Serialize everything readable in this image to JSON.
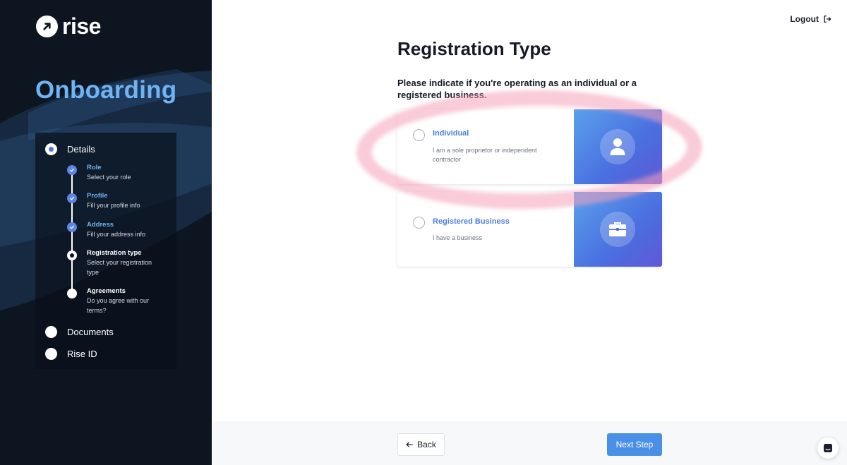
{
  "brand": {
    "logo_text": "rise",
    "logo_icon": "arrow-up-right-icon"
  },
  "sidebar": {
    "title": "Onboarding",
    "steps": [
      {
        "label": "Details",
        "state": "current"
      },
      {
        "label": "Documents",
        "state": "pending"
      },
      {
        "label": "Rise ID",
        "state": "pending"
      }
    ],
    "substeps": [
      {
        "title": "Role",
        "desc": "Select your role",
        "state": "done"
      },
      {
        "title": "Profile",
        "desc": "Fill your profile info",
        "state": "done"
      },
      {
        "title": "Address",
        "desc": "Fill your address info",
        "state": "done"
      },
      {
        "title": "Registration type",
        "desc": "Select your registration type",
        "state": "current"
      },
      {
        "title": "Agreements",
        "desc": "Do you agree with our terms?",
        "state": "pending"
      }
    ]
  },
  "header": {
    "logout_label": "Logout",
    "logout_icon": "logout-icon"
  },
  "main": {
    "title": "Registration Type",
    "subtitle": "Please indicate if you're operating as an individual or a registered business.",
    "options": [
      {
        "title": "Individual",
        "desc": "I am a sole proprietor or independent contractor",
        "icon": "user-icon",
        "selected": false
      },
      {
        "title": "Registered Business",
        "desc": "I have a business",
        "icon": "briefcase-icon",
        "selected": false
      }
    ]
  },
  "footer": {
    "back_label": "Back",
    "next_label": "Next Step"
  },
  "colors": {
    "accent": "#4a90e6",
    "sidebar_bg": "#0d1520",
    "title_blue": "#6fb4f5",
    "highlight": "#f5a0b9"
  }
}
